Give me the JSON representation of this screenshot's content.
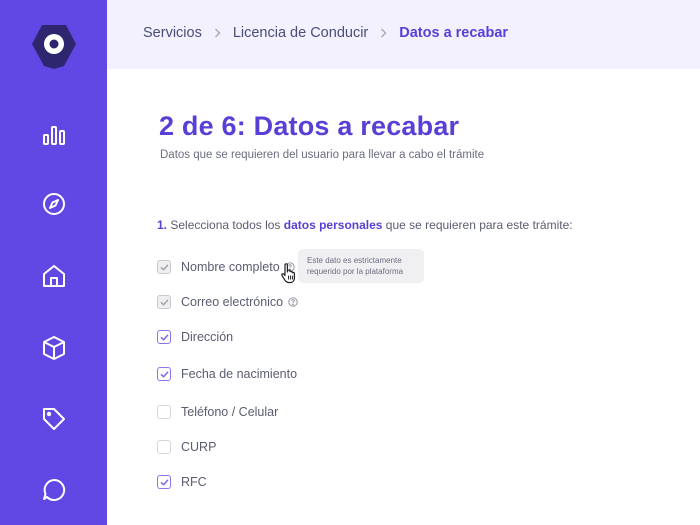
{
  "breadcrumb": {
    "items": [
      "Servicios",
      "Licencia de Conducir"
    ],
    "current": "Datos a recabar"
  },
  "page": {
    "title": "2 de 6: Datos a recabar",
    "subtitle": "Datos que se requieren del usuario para llevar a cabo el trámite"
  },
  "question": {
    "number": "1.",
    "pre": " Selecciona todos los ",
    "highlight": "datos personales",
    "post": " que se requieren para este trámite:"
  },
  "options": [
    {
      "label": "Nombre completo",
      "state": "locked"
    },
    {
      "label": "Correo electrónico",
      "state": "locked"
    },
    {
      "label": "Dirección",
      "state": "checked"
    },
    {
      "label": "Fecha de nacimiento",
      "state": "checked"
    },
    {
      "label": "Teléfono / Celular",
      "state": "unchecked"
    },
    {
      "label": "CURP",
      "state": "unchecked"
    },
    {
      "label": "RFC",
      "state": "checked"
    }
  ],
  "tooltip": {
    "line1": "Este dato es estrictamente",
    "line2": "requerido por la plataforma"
  },
  "colors": {
    "sidebar": "#6147e4",
    "accent": "#5a3fd6",
    "topbar": "#f3f1fd",
    "check": "#8b74ee"
  },
  "icons": [
    "logo-icon",
    "chart-icon",
    "compass-icon",
    "home-icon",
    "box-icon",
    "tag-icon",
    "chat-icon",
    "help-icon",
    "check-icon",
    "hand-cursor-icon"
  ]
}
